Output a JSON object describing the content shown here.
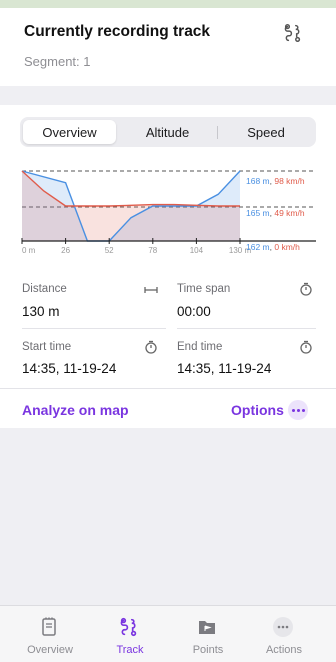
{
  "header": {
    "title": "Currently recording track",
    "subtitle": "Segment: 1",
    "track_icon": "track-route-icon"
  },
  "segmented_control": {
    "selected": "Overview",
    "options": [
      "Overview",
      "Altitude",
      "Speed"
    ]
  },
  "chart_data": {
    "type": "line",
    "x": [
      0,
      26,
      52,
      78,
      104,
      130
    ],
    "x_tick_labels": [
      "0 m",
      "26",
      "52",
      "78",
      "104",
      "130 m"
    ],
    "series": [
      {
        "color": "#4a90e2",
        "x": [
          0,
          26,
          39,
          52,
          65,
          78,
          91,
          104,
          117,
          130
        ],
        "values": [
          168,
          167,
          162,
          162,
          164,
          165,
          165,
          165,
          166,
          168
        ]
      },
      {
        "color": "#e05c4b",
        "x": [
          0,
          13,
          26,
          39,
          52,
          65,
          78,
          91,
          104,
          117,
          130
        ],
        "values": [
          98,
          70,
          49,
          49,
          49,
          50,
          51,
          51,
          50,
          49,
          49
        ]
      }
    ],
    "right_labels": [
      {
        "altitude": "168 m",
        "separator": ", ",
        "speed": "98 km/h"
      },
      {
        "altitude": "165 m",
        "separator": ", ",
        "speed": "49 km/h"
      },
      {
        "altitude": "162 m",
        "separator": ", ",
        "speed": "0 km/h"
      }
    ],
    "altitude_range": [
      162,
      168
    ],
    "speed_range": [
      0,
      98
    ],
    "colors": {
      "altitude": "#4a90e2",
      "speed": "#e05c4b"
    }
  },
  "stats": {
    "distance": {
      "label": "Distance",
      "value": "130 m",
      "icon": "ruler-icon"
    },
    "time_span": {
      "label": "Time span",
      "value": "00:00",
      "icon": "stopwatch-icon"
    },
    "start_time": {
      "label": "Start time",
      "value": "14:35, 11-19-24",
      "icon": "stopwatch-icon"
    },
    "end_time": {
      "label": "End time",
      "value": "14:35, 11-19-24",
      "icon": "stopwatch-icon"
    }
  },
  "actions": {
    "analyze": "Analyze on map",
    "options": "Options"
  },
  "tabbar": {
    "selected": "Track",
    "tabs": [
      {
        "label": "Overview",
        "icon": "notebook-icon"
      },
      {
        "label": "Track",
        "icon": "track-route-icon"
      },
      {
        "label": "Points",
        "icon": "folder-flag-icon"
      },
      {
        "label": "Actions",
        "icon": "more-icon"
      }
    ]
  },
  "colors": {
    "accent": "#7a35e0"
  }
}
